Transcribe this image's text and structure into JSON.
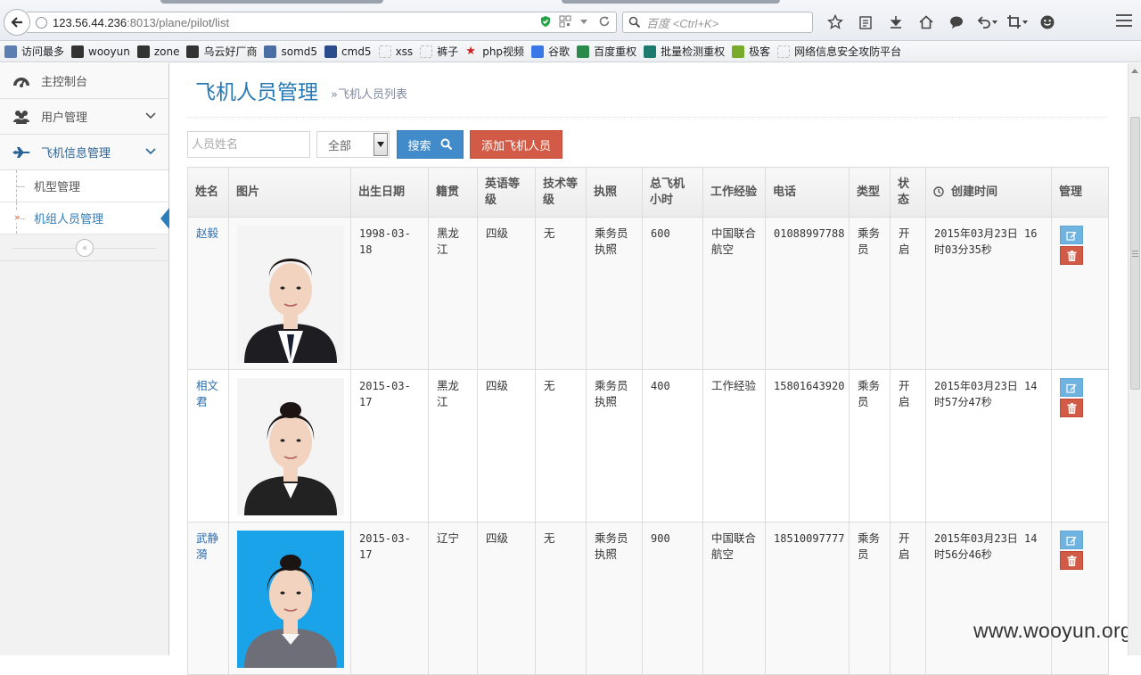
{
  "browser": {
    "url_host": "123.56.44.236",
    "url_path": ":8013/plane/pilot/list",
    "search_placeholder": "百度 <Ctrl+K>",
    "bookmarks": [
      {
        "label": "访问最多",
        "icon": "bookmark-icon",
        "color": "#5a7fb0"
      },
      {
        "label": "wooyun",
        "icon": "wooyun-icon",
        "color": "#333333"
      },
      {
        "label": "zone",
        "icon": "wooyun-icon",
        "color": "#333333"
      },
      {
        "label": "乌云好厂商",
        "icon": "wooyun-icon",
        "color": "#333333"
      },
      {
        "label": "somd5",
        "icon": "somd5-icon",
        "color": "#4a6fa5"
      },
      {
        "label": "cmd5",
        "icon": "grid-icon",
        "color": "#2b4c8c"
      },
      {
        "label": "xss",
        "icon": "page-icon",
        "color": "#bbbbbb"
      },
      {
        "label": "裤子",
        "icon": "page-icon",
        "color": "#bbbbbb"
      },
      {
        "label": "php视频",
        "icon": "star-icon",
        "color": "#d21f1f"
      },
      {
        "label": "谷歌",
        "icon": "google-icon",
        "color": "#3b78e7"
      },
      {
        "label": "百度重权",
        "icon": "leaf-icon",
        "color": "#2a8a4a"
      },
      {
        "label": "批量检测重权",
        "icon": "leaf-icon",
        "color": "#1e7a6e"
      },
      {
        "label": "极客",
        "icon": "geek-icon",
        "color": "#7aaa2a"
      },
      {
        "label": "网络信息安全攻防平台",
        "icon": "page-icon",
        "color": "#bbbbbb"
      }
    ]
  },
  "sidebar": {
    "items": [
      {
        "label": "主控制台",
        "icon": "dashboard-icon",
        "has_submenu": false
      },
      {
        "label": "用户管理",
        "icon": "users-icon",
        "has_submenu": true
      },
      {
        "label": "飞机信息管理",
        "icon": "plane-icon",
        "has_submenu": true,
        "active": true
      }
    ],
    "subitems": [
      {
        "label": "机型管理"
      },
      {
        "label": "机组人员管理",
        "active": true
      }
    ],
    "collapse_glyph": "«"
  },
  "page": {
    "title": "飞机人员管理",
    "subtitle": "»飞机人员列表"
  },
  "toolbar": {
    "name_placeholder": "人员姓名",
    "select_value": "全部",
    "search_label": "搜索",
    "add_label": "添加飞机人员"
  },
  "table": {
    "headers": [
      "姓名",
      "图片",
      "出生日期",
      "籍贯",
      "英语等级",
      "技术等级",
      "执照",
      "总飞机小时",
      "工作经验",
      "电话",
      "类型",
      "状态",
      "创建时间",
      "管理"
    ],
    "rows": [
      {
        "name": "赵毅",
        "birth": "1998-03-18",
        "origin": "黑龙江",
        "english": "四级",
        "tech": "无",
        "license": "乘务员执照",
        "hours": "600",
        "experience": "中国联合航空",
        "phone": "01088997788",
        "type": "乘务员",
        "status": "开启",
        "created": "2015年03月23日 16时03分35秒"
      },
      {
        "name": "相文君",
        "birth": "2015-03-17",
        "origin": "黑龙江",
        "english": "四级",
        "tech": "无",
        "license": "乘务员执照",
        "hours": "400",
        "experience": "工作经验",
        "phone": "15801643920",
        "type": "乘务员",
        "status": "开启",
        "created": "2015年03月23日 14时57分47秒"
      },
      {
        "name": "武静漪",
        "birth": "2015-03-17",
        "origin": "辽宁",
        "english": "四级",
        "tech": "无",
        "license": "乘务员执照",
        "hours": "900",
        "experience": "中国联合航空",
        "phone": "18510097777",
        "type": "乘务员",
        "status": "开启",
        "created": "2015年03月23日 14时56分46秒"
      }
    ]
  },
  "colors": {
    "primary": "#428bca",
    "danger": "#d15b47",
    "title_blue": "#2679b5",
    "edit_btn": "#6fb3e0"
  },
  "watermark": "www.wooyun.org"
}
